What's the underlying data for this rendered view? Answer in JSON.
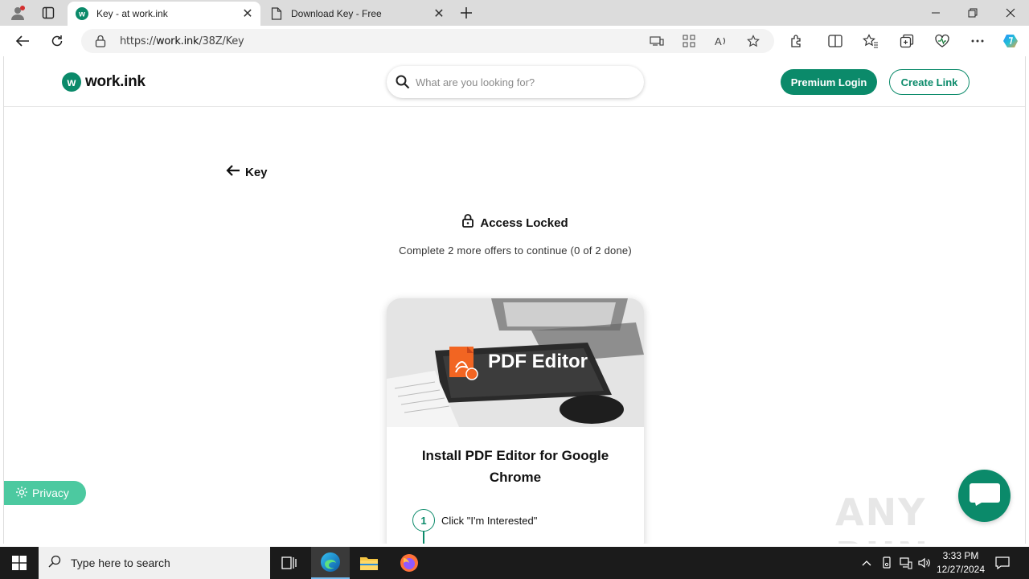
{
  "browser": {
    "tabs": [
      {
        "title": "Key - at work.ink",
        "active": true
      },
      {
        "title": "Download Key - Free",
        "active": false
      }
    ],
    "url_prefix": "https://",
    "url_host": "work.ink",
    "url_path": "/38Z/Key"
  },
  "header": {
    "logo_text": "work.ink",
    "logo_letter": "w",
    "search_placeholder": "What are you looking for?",
    "premium_login_label": "Premium Login",
    "create_link_label": "Create Link"
  },
  "main": {
    "back_label": "Key",
    "access_title": "Access Locked",
    "progress_text": "Complete 2 more offers to continue (0 of 2 done)",
    "offer": {
      "image_label": "PDF Editor",
      "title": "Install PDF Editor for Google Chrome",
      "steps": [
        {
          "number": "1",
          "text": "Click \"I'm Interested\""
        }
      ]
    }
  },
  "privacy_label": "Privacy",
  "watermark": "ANY RUN",
  "taskbar": {
    "search_placeholder": "Type here to search",
    "time": "3:33 PM",
    "date": "12/27/2024"
  },
  "colors": {
    "brand": "#0b8a6a",
    "privacy": "#4cc9a0",
    "pdf_icon": "#f26522"
  }
}
